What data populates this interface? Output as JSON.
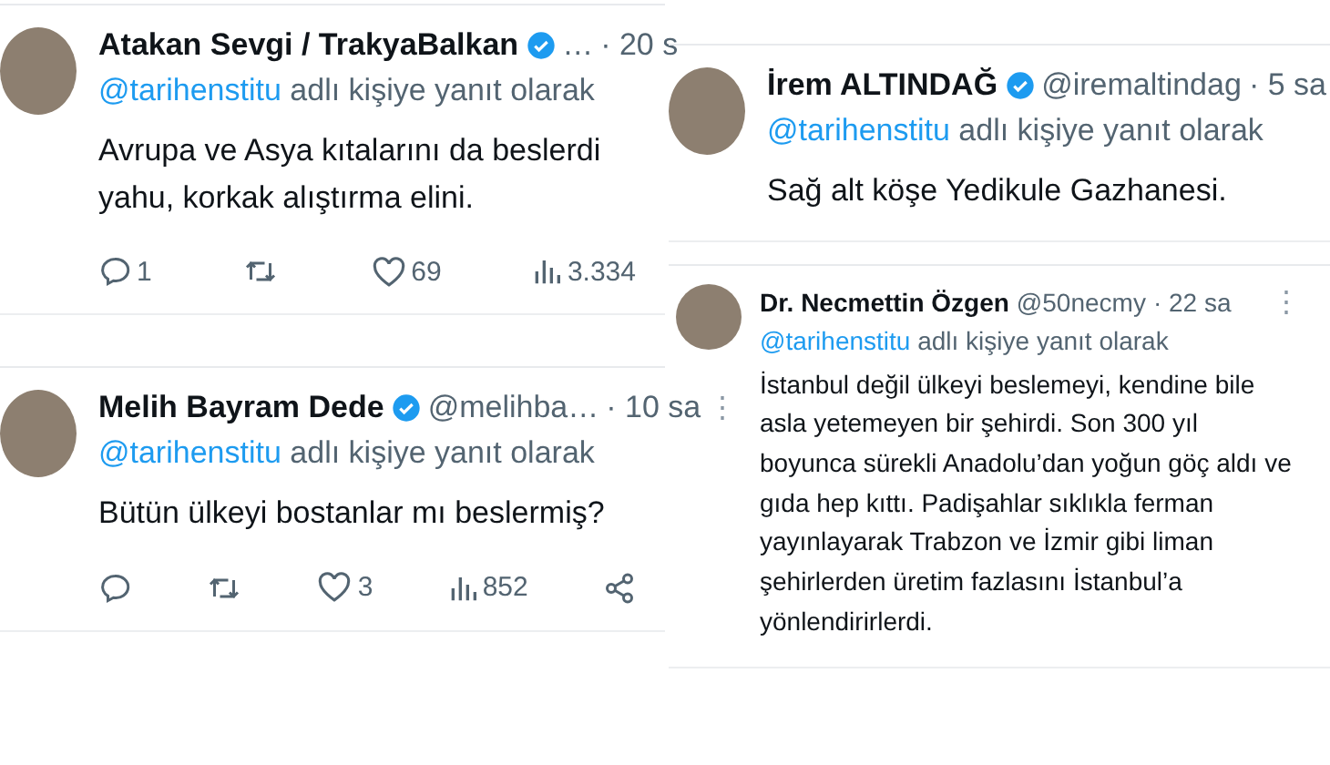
{
  "left_column": [
    {
      "kind": "large",
      "name": "Atakan Sevgi / TrakyaBalkan",
      "verified": true,
      "handle": "…",
      "time": "· 20 s",
      "mention": "@tarihenstitu",
      "reply_label": "adlı kişiye yanıt olarak",
      "text": "Avrupa ve Asya kıtalarını da beslerdi yahu, korkak alıştırma elini.",
      "actions": [
        {
          "kind": "reply",
          "count": "1"
        },
        {
          "kind": "repost"
        },
        {
          "kind": "like",
          "count": "69"
        },
        {
          "kind": "views",
          "count": "3.334"
        }
      ]
    },
    {
      "kind": "large",
      "name": "Melih Bayram Dede",
      "verified": true,
      "handle": "@melihba…",
      "time": "· 10 sa",
      "more_icon": "⋮",
      "mention": "@tarihenstitu",
      "reply_label": "adlı kişiye yanıt olarak",
      "text": "Bütün ülkeyi bostanlar mı beslermiş?",
      "actions": [
        {
          "kind": "reply"
        },
        {
          "kind": "repost"
        },
        {
          "kind": "like",
          "count": "3"
        },
        {
          "kind": "views",
          "count": "852"
        },
        {
          "kind": "share"
        }
      ]
    }
  ],
  "right_column": [
    {
      "kind": "large",
      "name": "İrem ALTINDAĞ",
      "verified": true,
      "handle": "@iremaltindag",
      "time": "· 5 sa",
      "mention": "@tarihenstitu",
      "reply_label": "adlı kişiye yanıt olarak",
      "text": "Sağ alt köşe Yedikule Gazhanesi."
    },
    {
      "kind": "compact",
      "name": "Dr. Necmettin Özgen",
      "verified": false,
      "handle": "@50necmy",
      "time": "· 22 sa",
      "more_icon": "⋮",
      "mention": "@tarihenstitu",
      "reply_label": "adlı kişiye yanıt olarak",
      "text": "İstanbul değil ülkeyi beslemeyi, kendine bile asla yetemeyen bir şehirdi. Son 300 yıl boyunca sürekli Anadolu’dan yoğun göç aldı ve gıda hep kıttı. Padişahlar sıklıkla ferman yayınlayarak Trabzon ve İzmir gibi liman şehirlerden üretim fazlasını İstanbul’a yönlendirirlerdi."
    }
  ]
}
